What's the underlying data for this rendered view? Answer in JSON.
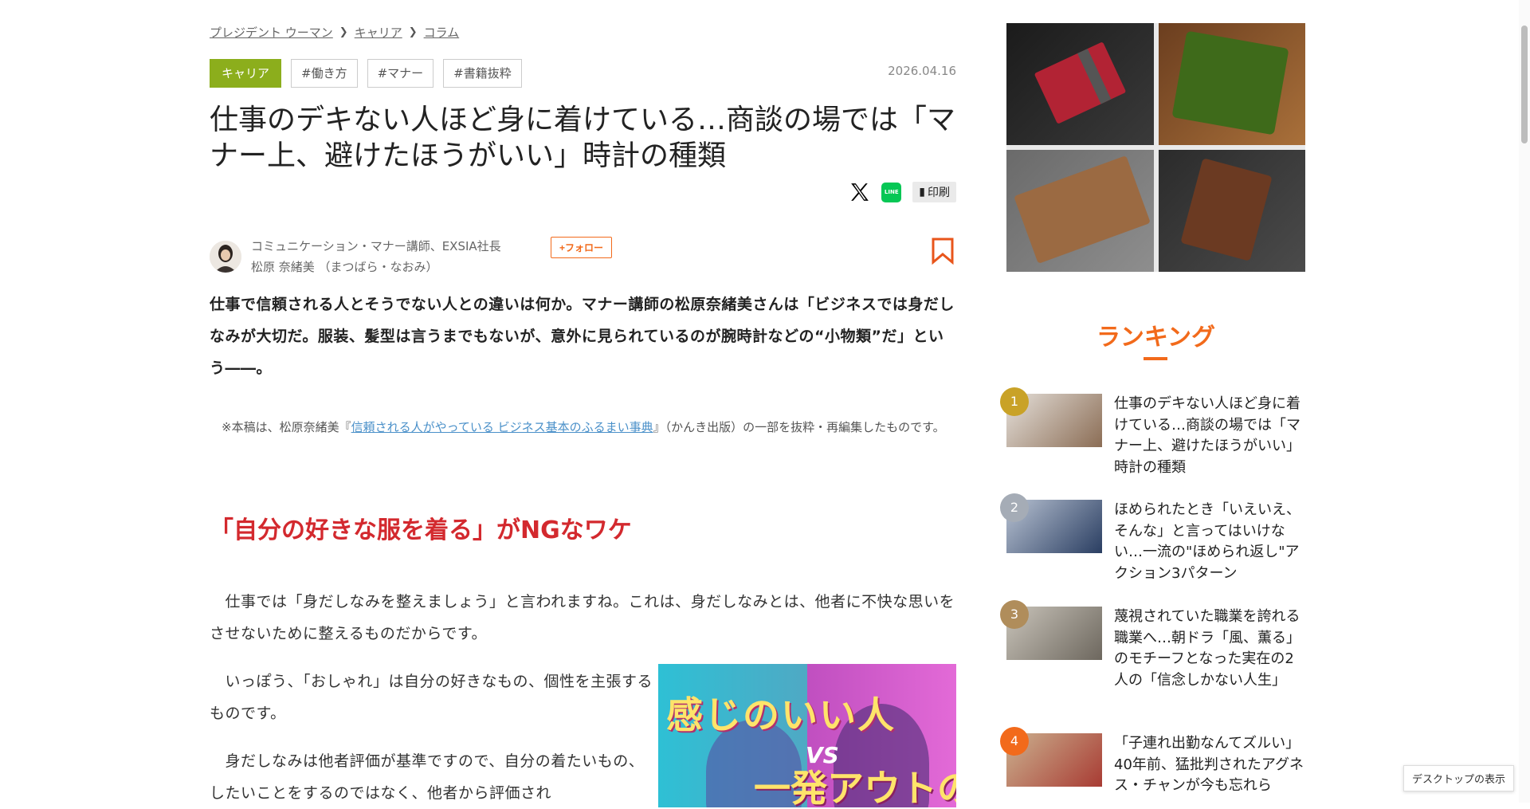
{
  "breadcrumb": {
    "items": [
      "プレジデント ウーマン",
      "キャリア",
      "コラム"
    ]
  },
  "tags": {
    "category": "キャリア",
    "items": [
      "#働き方",
      "#マナー",
      "#書籍抜粋"
    ]
  },
  "article": {
    "date": "2026.04.16",
    "title": "仕事のデキない人ほど身に着けている…商談の場では「マナー上、避けたほうがいい」時計の種類",
    "print_label": "印刷",
    "author_role": "コミュニケーション・マナー講師、EXSIA社長",
    "follow_label": "+フォロー",
    "author_name": "松原 奈緒美 （まつばら・なおみ）",
    "lead": "仕事で信頼される人とそうでない人との違いは何か。マナー講師の松原奈緒美さんは「ビジネスでは身だしなみが大切だ。服装、髪型は言うまでもないが、意外に見られているのが腕時計などの“小物類”だ」という――。",
    "note_prefix": "※本稿は、松原奈緒美『",
    "note_link": "信頼される人がやっている ビジネス基本のふるまい事典",
    "note_suffix": "』（かんき出版）の一部を抜粋・再編集したものです。",
    "section_heading": "「自分の好きな服を着る」がNGなワケ",
    "paragraphs": [
      "仕事では「身だしなみを整えましょう」と言われますね。これは、身だしなみとは、他者に不快な思いをさせないために整えるものだからです。",
      "いっぽう、「おしゃれ」は自分の好きなもの、個性を主張するものです。",
      "身だしなみは他者評価が基準ですので、自分の着たいもの、したいことをするのではなく、他者から評価され"
    ],
    "book_cover_text": [
      "感じのいい人",
      "VS",
      "一発アウトの人"
    ]
  },
  "sidebar": {
    "ranking_title": "ランキング",
    "ranking": [
      {
        "rank": "1",
        "color": "#c9a227",
        "text": "仕事のデキない人ほど身に着けている…商談の場では「マナー上、避けたほうがいい」時計の種類"
      },
      {
        "rank": "2",
        "color": "#a5acb6",
        "text": "ほめられたとき「いえいえ、そんな」と言ってはいけない…一流の\"ほめられ返し\"アクション3パターン"
      },
      {
        "rank": "3",
        "color": "#b08d5b",
        "text": "蔑視されていた職業を誇れる職業へ…朝ドラ「風、薫る」のモチーフとなった実在の2人の「信念しかない人生」"
      },
      {
        "rank": "4",
        "color": "#f26a1b",
        "text": "「子連れ出勤なんてズルい」40年前、猛批判されたアグネス・チャンが今も忘れら"
      }
    ]
  },
  "ui": {
    "desktop_link": "デスクトップの表示"
  },
  "colors": {
    "accent_orange": "#f26a1b",
    "tag_green": "#8cae1c",
    "heading_red": "#d3292e",
    "link_blue": "#4a90c9"
  }
}
